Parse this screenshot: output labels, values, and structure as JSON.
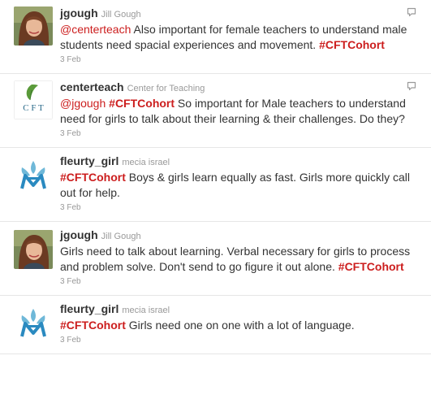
{
  "tweets": [
    {
      "handle": "jgough",
      "fullname": "Jill Gough",
      "avatar": "person-photo",
      "parts": [
        {
          "t": "mention",
          "v": "@centerteach"
        },
        {
          "t": "text",
          "v": " Also important for female teachers to understand male students need spacial experiences and movement. "
        },
        {
          "t": "hashtag",
          "v": "#CFTCohort"
        }
      ],
      "time": "3 Feb",
      "has_reply_icon": true
    },
    {
      "handle": "centerteach",
      "fullname": "Center for Teaching",
      "avatar": "cft-logo",
      "avatar_text": "CFT",
      "parts": [
        {
          "t": "mention",
          "v": "@jgough"
        },
        {
          "t": "text",
          "v": " "
        },
        {
          "t": "hashtag",
          "v": "#CFTCohort"
        },
        {
          "t": "text",
          "v": " So important for Male teachers to understand need for girls to talk about their learning & their challenges. Do they?"
        }
      ],
      "time": "3 Feb",
      "has_reply_icon": true
    },
    {
      "handle": "fleurty_girl",
      "fullname": "mecia israel",
      "avatar": "fleur-logo",
      "parts": [
        {
          "t": "hashtag",
          "v": "#CFTCohort"
        },
        {
          "t": "text",
          "v": " Boys & girls learn equally as fast. Girls more quickly call out for help."
        }
      ],
      "time": "3 Feb",
      "has_reply_icon": false
    },
    {
      "handle": "jgough",
      "fullname": "Jill Gough",
      "avatar": "person-photo",
      "parts": [
        {
          "t": "text",
          "v": "Girls need to talk about learning. Verbal necessary for girls to process and problem solve. Don't send to go figure it out alone. "
        },
        {
          "t": "hashtag",
          "v": "#CFTCohort"
        }
      ],
      "time": "3 Feb",
      "has_reply_icon": false
    },
    {
      "handle": "fleurty_girl",
      "fullname": "mecia israel",
      "avatar": "fleur-logo",
      "parts": [
        {
          "t": "hashtag",
          "v": "#CFTCohort"
        },
        {
          "t": "text",
          "v": " Girls need one on one with a lot of language."
        }
      ],
      "time": "3 Feb",
      "has_reply_icon": false
    }
  ],
  "colors": {
    "link": "#cc1e1e",
    "muted": "#999999",
    "text": "#333333"
  }
}
